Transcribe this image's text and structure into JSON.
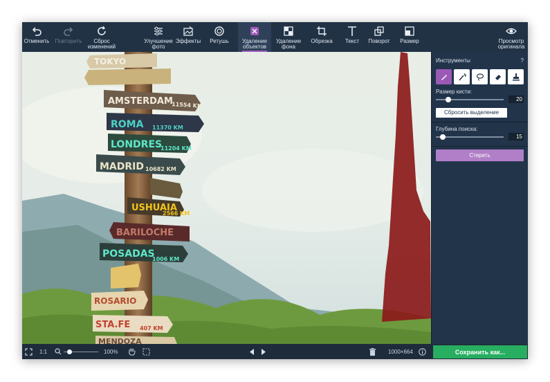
{
  "toolbar": {
    "undo": "Отменить",
    "redo": "Повторить",
    "reset": "Сброс\nизменений",
    "enhance": "Улучшение\nфото",
    "effects": "Эффекты",
    "retouch": "Ретушь",
    "remove_objects": "Удаление\nобъектов",
    "remove_background": "Удаление\nфона",
    "crop": "Обрезка",
    "text": "Текст",
    "rotate": "Поворот",
    "resize": "Размер",
    "view_original": "Просмотр\nоригинала"
  },
  "panel": {
    "tools_label": "Инструменты",
    "help": "?",
    "brush_size_label": "Размер кисти:",
    "brush_size_value": "20",
    "brush_size_fraction": 0.18,
    "reset_selection": "Сбросить выделение",
    "search_depth_label": "Глубина поиска:",
    "search_depth_value": "15",
    "search_depth_fraction": 0.06,
    "erase": "Стереть"
  },
  "statusbar": {
    "ratio": "1:1",
    "zoom": "100%",
    "zoom_fraction": 0.1,
    "dimensions": "1000×664"
  },
  "save_button": "Сохранить как...",
  "signs": [
    "TOKYO",
    "AMSTERDAM",
    "11554 KM",
    "ROMA",
    "11370 KM",
    "LONDRES",
    "11204 KM",
    "MADRID",
    "10682 KM",
    "USHUAIA",
    "2566 KM",
    "BARILOCHE",
    "POSADAS",
    "1006 KM",
    "ROSARIO",
    "STA.FE",
    "407 KM",
    "MENDOZA"
  ],
  "colors": {
    "accent": "#9b59b6",
    "selection_mask": "#8b1a1a",
    "save": "#27ae60"
  }
}
